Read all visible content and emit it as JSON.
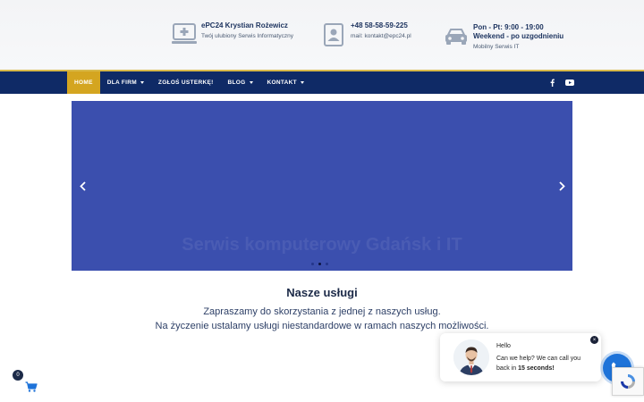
{
  "header": {
    "company": {
      "title": "ePC24 Krystian Rożewicz",
      "subtitle": "Twój ulubiony Serwis Informatyczny",
      "icon": "computer-icon"
    },
    "contact": {
      "phone": "+48 58-58-59-225",
      "email": "mail: kontakt@epc24.pl",
      "icon": "contact-card-icon"
    },
    "hours": {
      "line1": "Pon - Pt: 9:00 - 19:00",
      "line2": "Weekend - po uzgodnieniu",
      "subtitle": "Mobilny Serwis IT",
      "icon": "car-icon"
    }
  },
  "nav": {
    "items": [
      {
        "label": "HOME",
        "active": true,
        "dropdown": false
      },
      {
        "label": "DLA FIRM",
        "active": false,
        "dropdown": true
      },
      {
        "label": "ZGŁOŚ USTERKĘ!",
        "active": false,
        "dropdown": false
      },
      {
        "label": "BLOG",
        "active": false,
        "dropdown": true
      },
      {
        "label": "KONTAKT",
        "active": false,
        "dropdown": true
      }
    ],
    "social": [
      "facebook-icon",
      "youtube-icon"
    ]
  },
  "slider": {
    "background": "#3b4fae",
    "ghost_text": "Serwis komputerowy Gdańsk i IT",
    "slide_count": 3,
    "active_slide": 2
  },
  "services": {
    "title": "Nasze usługi",
    "line1": "Zapraszamy do skorzystania z jednej z naszych usług.",
    "line2": "Na życzenie ustalamy usługi niestandardowe w ramach naszych możliwości."
  },
  "cart": {
    "count": "0"
  },
  "callback": {
    "hello": "Hello",
    "message_start": "Can we help? We can call you back in ",
    "message_bold": "15 seconds!",
    "close_glyph": "×"
  },
  "colors": {
    "nav": "#0f2a66",
    "accent": "#d4a520",
    "call": "#1e73d9",
    "heading": "#1c2a48"
  }
}
